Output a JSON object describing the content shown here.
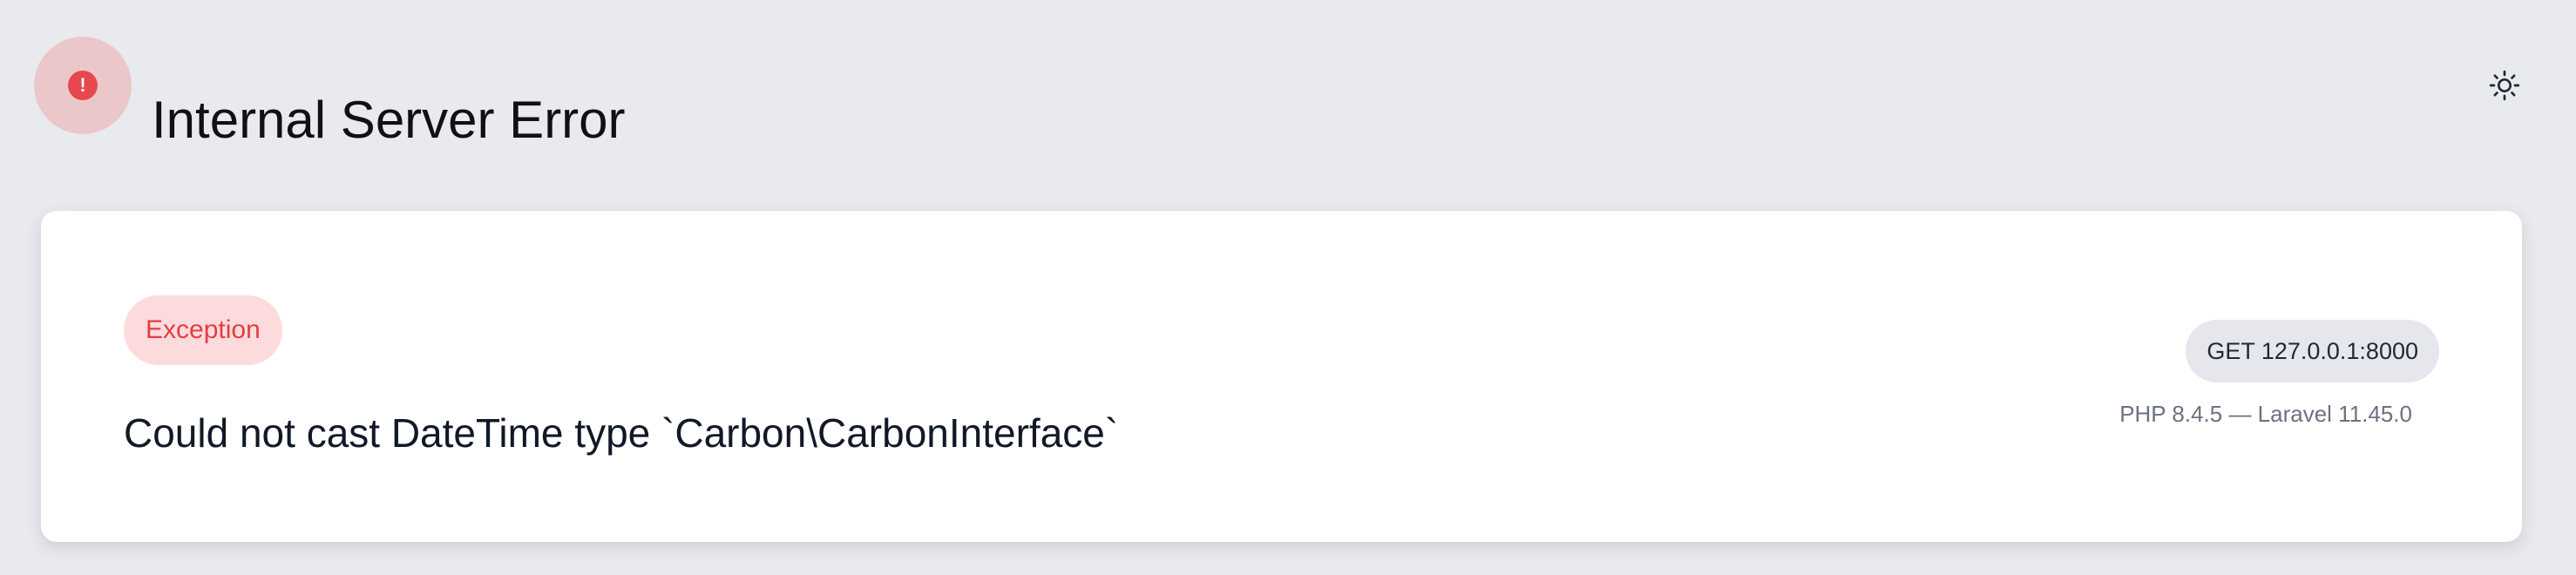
{
  "header": {
    "title": "Internal Server Error",
    "error_icon": "exclamation-circle-icon",
    "theme_toggle_icon": "sun-icon"
  },
  "error_card": {
    "exception_label": "Exception",
    "message": "Could not cast DateTime type `Carbon\\CarbonInterface`",
    "request": "GET 127.0.0.1:8000",
    "version_info": "PHP 8.4.5 — Laravel 11.45.0"
  },
  "colors": {
    "background": "#e9eaee",
    "card": "#ffffff",
    "error_accent": "#e5484d",
    "error_soft": "#ecc7ca",
    "badge_background": "#fddbdd",
    "request_badge_background": "#e6e7ec",
    "muted_text": "#6b7280"
  }
}
